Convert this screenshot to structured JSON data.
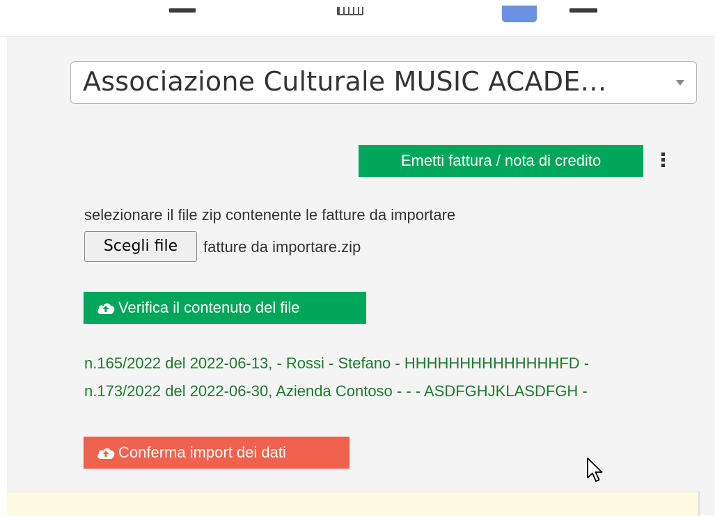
{
  "header": {
    "icons": [
      "menu-icon",
      "calendar-icon",
      "user-icon",
      "exit-icon"
    ],
    "user_badge_color": "#6b92e0"
  },
  "association_select": {
    "selected": "Associazione Culturale MUSIC ACADE…"
  },
  "toolbar": {
    "emit_label": "Emetti fattura / nota di credito",
    "emit_color": "#00a65a"
  },
  "import": {
    "instruction": "selezionare il file zip contenente le fatture da importare",
    "file_button_label": "Scegli file",
    "file_name": "fatture da importare.zip",
    "verify_label": "Verifica il contenuto del file",
    "verify_color": "#00a65a",
    "results": [
      "n.165/2022 del 2022-06-13, - Rossi - Stefano - HHHHHHHHHHHHHHFD -",
      "n.173/2022 del 2022-06-30, Azienda Contoso - - - ASDFGHJKLASDFGH -"
    ],
    "results_color": "#1d7a2a",
    "confirm_label": "Conferma import dei dati",
    "confirm_color": "#f0624d"
  }
}
